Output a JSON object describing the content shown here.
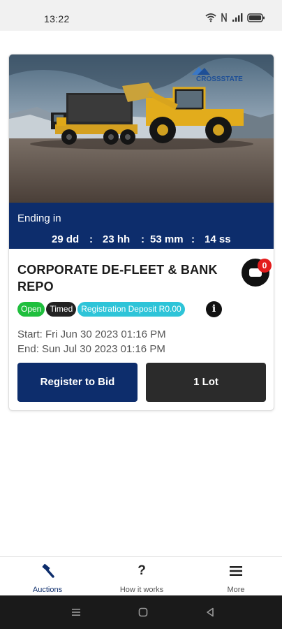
{
  "status_bar": {
    "time": "13:22"
  },
  "auction": {
    "brand": "CROSSSTATE",
    "ending_label": "Ending in",
    "countdown": {
      "days": "29 dd",
      "hours": "23 hh",
      "minutes": "53 mm",
      "seconds": "14 ss",
      "separator": ":"
    },
    "title": "CORPORATE DE-FLEET & BANK REPO",
    "watch_count": "0",
    "badges": {
      "status": "Open",
      "type": "Timed",
      "deposit": "Registration Deposit R0.00"
    },
    "start": "Start: Fri Jun 30 2023 01:16 PM",
    "end": "End: Sun Jul 30 2023 01:16 PM",
    "register_label": "Register to Bid",
    "lots_label": "1 Lot"
  },
  "nav": {
    "items": [
      {
        "label": "Auctions",
        "icon": "gavel-icon"
      },
      {
        "label": "How it works",
        "icon": "question-icon"
      },
      {
        "label": "More",
        "icon": "menu-icon"
      }
    ]
  },
  "colors": {
    "primary": "#0d2d6c",
    "dark": "#2b2b2b",
    "open": "#1fbf3d",
    "deposit": "#2ec4d8",
    "badge_red": "#e31c1c"
  }
}
